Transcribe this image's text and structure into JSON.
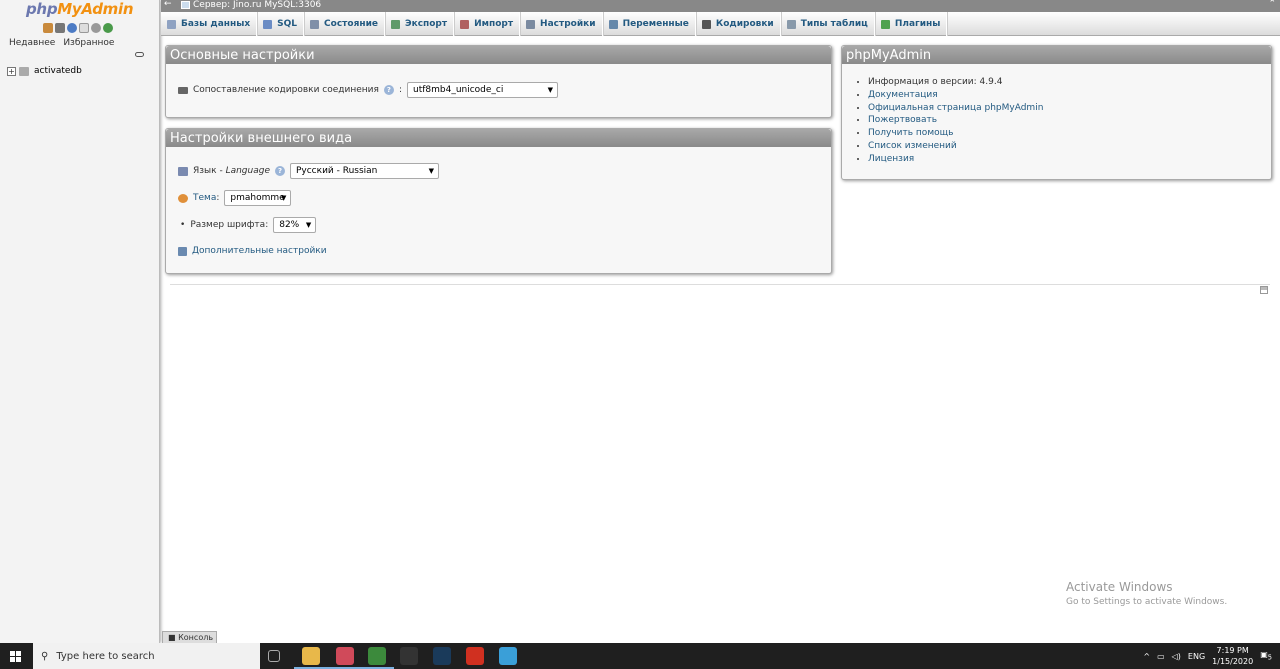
{
  "nav": {
    "logo_php": "php",
    "logo_my": "MyAdmin",
    "tab_recent": "Недавнее",
    "tab_favorites": "Избранное",
    "databases": [
      {
        "expander": "+",
        "name": "activatedb"
      }
    ]
  },
  "topbar": {
    "toggle": "←",
    "server": "Сервер: Jino.ru MySQL:3306",
    "collapse": "⌃"
  },
  "menu": [
    {
      "label": "Базы данных",
      "icon": "databases-icon",
      "color": "#8fa2c2"
    },
    {
      "label": "SQL",
      "icon": "sql-icon",
      "color": "#6b8cc4"
    },
    {
      "label": "Состояние",
      "icon": "status-icon",
      "color": "#7f8fa8"
    },
    {
      "label": "Экспорт",
      "icon": "export-icon",
      "color": "#5f9a6a"
    },
    {
      "label": "Импорт",
      "icon": "import-icon",
      "color": "#b06060"
    },
    {
      "label": "Настройки",
      "icon": "settings-icon",
      "color": "#7a8aa0"
    },
    {
      "label": "Переменные",
      "icon": "variables-icon",
      "color": "#6688aa"
    },
    {
      "label": "Кодировки",
      "icon": "charsets-icon",
      "color": "#555555"
    },
    {
      "label": "Типы таблиц",
      "icon": "engines-icon",
      "color": "#8899aa"
    },
    {
      "label": "Плагины",
      "icon": "plugins-icon",
      "color": "#4fa24f"
    }
  ],
  "general": {
    "title": "Основные настройки",
    "collation_label": "Сопоставление кодировки соединения",
    "collation_colon": ":",
    "collation_value": "utf8mb4_unicode_ci"
  },
  "appearance": {
    "title": "Настройки внешнего вида",
    "language_label": "Язык - ",
    "language_label_en": "Language",
    "language_value": "Русский - Russian",
    "theme_label": "Тема",
    "theme_colon": ":",
    "theme_value": "pmahomme",
    "fontsize_label": "Размер шрифта:",
    "fontsize_value": "82%",
    "more_settings": "Дополнительные настройки"
  },
  "pma": {
    "title": "phpMyAdmin",
    "items": [
      "Информация о версии: 4.9.4",
      "Документация",
      "Официальная страница phpMyAdmin",
      "Пожертвовать",
      "Получить помощь",
      "Список изменений",
      "Лицензия"
    ]
  },
  "console": {
    "label": "Консоль"
  },
  "watermark": {
    "line1": "Activate Windows",
    "line2": "Go to Settings to activate Windows."
  },
  "taskbar": {
    "search_placeholder": "Type here to search",
    "lang": "ENG",
    "time": "7:19 PM",
    "date": "1/15/2020",
    "notifications": "5",
    "icons": [
      {
        "name": "task-view-icon",
        "color": "#1f1f1f"
      },
      {
        "name": "file-explorer-icon",
        "color": "#e8b84a"
      },
      {
        "name": "app-icon",
        "color": "#d04a5a"
      },
      {
        "name": "chrome-icon",
        "color": "#3c8a3c"
      },
      {
        "name": "bm-app-icon",
        "color": "#333333"
      },
      {
        "name": "steam-icon",
        "color": "#1a3a5a"
      },
      {
        "name": "red-app-icon",
        "color": "#d03020"
      },
      {
        "name": "telegram-icon",
        "color": "#3a9fd8"
      }
    ]
  }
}
